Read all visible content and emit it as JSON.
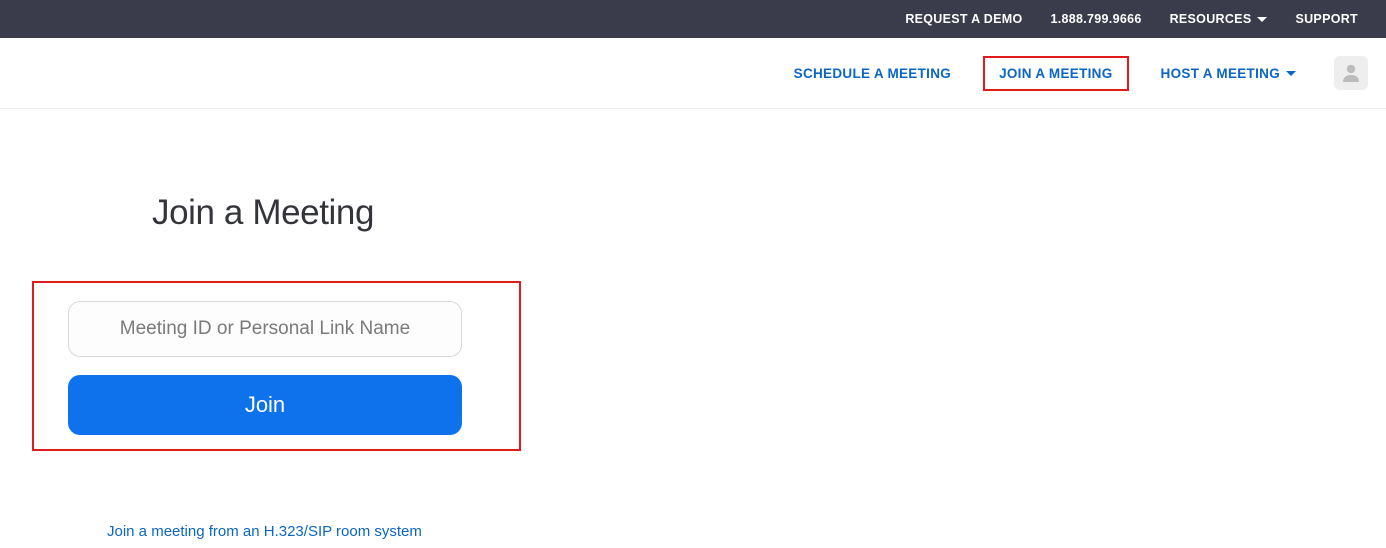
{
  "topbar": {
    "request_demo": "REQUEST A DEMO",
    "phone": "1.888.799.9666",
    "resources": "RESOURCES",
    "support": "SUPPORT"
  },
  "mainbar": {
    "schedule": "SCHEDULE A MEETING",
    "join": "JOIN A MEETING",
    "host": "HOST A MEETING"
  },
  "page": {
    "title": "Join a Meeting",
    "meeting_placeholder": "Meeting ID or Personal Link Name",
    "join_button": "Join",
    "room_link": "Join a meeting from an H.323/SIP room system"
  }
}
